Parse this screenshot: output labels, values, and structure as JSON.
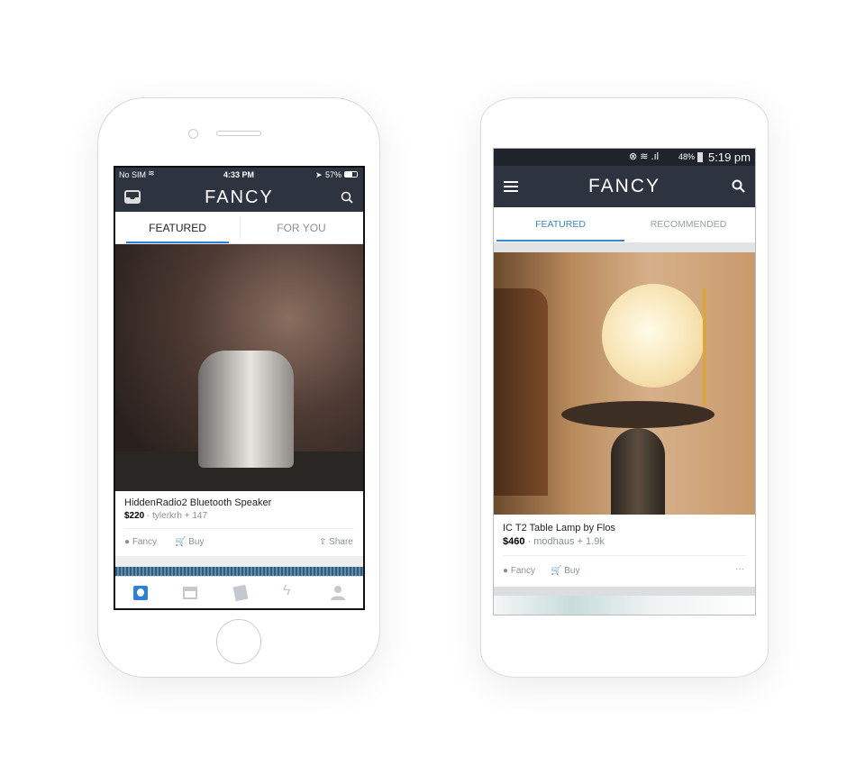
{
  "ios": {
    "status": {
      "carrier": "No SIM",
      "time": "4:33 PM",
      "battery": "57%"
    },
    "nav": {
      "logo": "FANCY"
    },
    "tabs": [
      {
        "label": "FEATURED",
        "active": true
      },
      {
        "label": "FOR YOU",
        "active": false
      }
    ],
    "card": {
      "title": "HiddenRadio2 Bluetooth Speaker",
      "price": "$220",
      "meta": "· tylerkrh + 147",
      "actions": {
        "fancy": "Fancy",
        "buy": "Buy",
        "share": "Share"
      }
    },
    "tabbar": [
      "fancy",
      "shop",
      "collections",
      "activity",
      "profile"
    ],
    "accent": "#2f7fd6"
  },
  "android": {
    "status": {
      "battery": "48%",
      "time": "5:19 pm"
    },
    "nav": {
      "logo": "FANCY"
    },
    "tabs": [
      {
        "label": "FEATURED",
        "active": true
      },
      {
        "label": "RECOMMENDED",
        "active": false
      }
    ],
    "card": {
      "title": "IC T2 Table Lamp by Flos",
      "price": "$460",
      "meta": "· modhaus + 1.9k",
      "actions": {
        "fancy": "Fancy",
        "buy": "Buy",
        "more": "···"
      }
    },
    "accent": "#3a86cf"
  }
}
